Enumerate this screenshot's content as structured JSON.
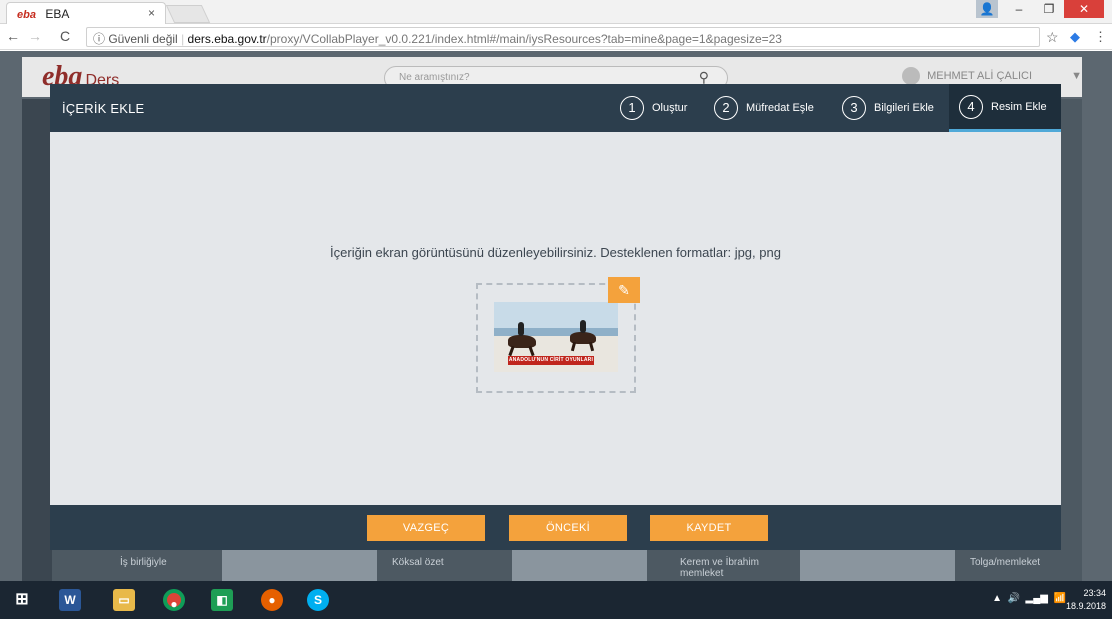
{
  "browser": {
    "tab_title": "EBA",
    "tab_favicon": "eba",
    "tab_close": "×",
    "address_security": "ⓘ Güvenli değil",
    "address_domain": "ders.eba.gov.tr",
    "address_path": "/proxy/VCollabPlayer_v0.0.221/index.html#/main/iysResources?tab=mine&page=1&pagesize=23"
  },
  "site": {
    "logo": "eba",
    "logo_sub": "Ders",
    "search_placeholder": "Ne aramıştınız?",
    "user_name": "MEHMET ALİ ÇALICI",
    "background_labels": [
      "İş birliğiyle",
      "Köksal özet",
      "Kerem ve İbrahim memleket",
      "Tolga/memleket"
    ]
  },
  "modal": {
    "title": "İÇERİK EKLE",
    "steps": [
      {
        "num": "1",
        "label": "Oluştur"
      },
      {
        "num": "2",
        "label": "Müfredat Eşle"
      },
      {
        "num": "3",
        "label": "Bilgileri Ekle"
      },
      {
        "num": "4",
        "label": "Resim Ekle",
        "active": true
      }
    ],
    "hint": "İçeriğin ekran görüntüsünü düzenleyebilirsiniz. Desteklenen formatlar: jpg, png",
    "image_banner": "ANADOLU'NUN CİRİT OYUNLARI",
    "buttons": {
      "cancel": "VAZGEÇ",
      "previous": "ÖNCEKİ",
      "save": "KAYDET"
    }
  },
  "taskbar": {
    "apps": [
      "windows-start",
      "word",
      "file-explorer",
      "chrome",
      "store",
      "firefox",
      "skype"
    ],
    "time": "23:34",
    "date": "18.9.2018"
  },
  "colors": {
    "modal_header": "#2c3e4d",
    "accent_orange": "#f4a23c",
    "active_step_underline": "#4fa9d8"
  }
}
